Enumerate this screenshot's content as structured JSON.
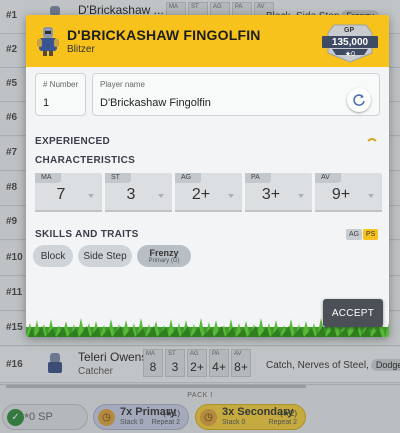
{
  "roster": {
    "rows": [
      {
        "num": "#1",
        "name": "D'Brickashaw ...",
        "skills": "Block, Side Step",
        "badge": "Frenzy"
      },
      {
        "num": "#2",
        "name": "",
        "skills": "",
        "badge": ""
      },
      {
        "num": "#5",
        "name": "",
        "skills": "",
        "badge": ""
      },
      {
        "num": "#6",
        "name": "",
        "skills": "",
        "badge": ""
      },
      {
        "num": "#7",
        "name": "",
        "skills": "",
        "badge": ""
      },
      {
        "num": "#8",
        "name": "",
        "skills": "",
        "badge": ""
      },
      {
        "num": "#9",
        "name": "",
        "skills": "",
        "badge": ""
      },
      {
        "num": "#10",
        "name": "",
        "skills": "",
        "badge": ""
      },
      {
        "num": "#11",
        "name": "",
        "skills": "",
        "badge": ""
      },
      {
        "num": "#15",
        "name": "",
        "skills": "",
        "badge": ""
      },
      {
        "num": "#16",
        "name": "Teleri Owens",
        "position": "Catcher",
        "skills": "Catch, Nerves of Steel,",
        "badge": "Dodge",
        "stats": [
          {
            "label": "MA",
            "value": "8"
          },
          {
            "label": "ST",
            "value": "3"
          },
          {
            "label": "AG",
            "value": "2+"
          },
          {
            "label": "PA",
            "value": "4+"
          },
          {
            "label": "AV",
            "value": "8+"
          }
        ]
      }
    ],
    "first_row_stat_labels": [
      "MA",
      "ST",
      "AG",
      "PA",
      "AV"
    ]
  },
  "pack": {
    "label": "PACK I",
    "items": [
      {
        "title": "0 SP",
        "star": "★"
      },
      {
        "title": "7x Primary",
        "star": "(★1)",
        "stack": "Stack 0",
        "repeat": "Repeat 2"
      },
      {
        "title": "3x Secondary",
        "star": "(★2)",
        "stack": "Stack 0",
        "repeat": "Repeat 2"
      }
    ]
  },
  "modal": {
    "player_name": "D'BRICKASHAW FINGOLFIN",
    "position": "Blitzer",
    "gp": {
      "caption": "GP",
      "value": "135,000",
      "sub": "★0"
    },
    "number": {
      "label": "# Number",
      "value": "1"
    },
    "name_field": {
      "label": "Player name",
      "value": "D'Brickashaw Fingolfin"
    },
    "experienced_label": "EXPERIENCED",
    "characteristics_label": "CHARACTERISTICS",
    "characteristics": [
      {
        "label": "MA",
        "value": "7"
      },
      {
        "label": "ST",
        "value": "3"
      },
      {
        "label": "AG",
        "value": "2+"
      },
      {
        "label": "PA",
        "value": "3+"
      },
      {
        "label": "AV",
        "value": "9+"
      }
    ],
    "skills_label": "SKILLS AND TRAITS",
    "tags": [
      "AG",
      "PS"
    ],
    "skills": [
      {
        "name": "Block"
      },
      {
        "name": "Side Step"
      },
      {
        "name": "Frenzy",
        "sub": "Primary (G)"
      }
    ],
    "accept_label": "ACCEPT"
  },
  "colors": {
    "header": "#f6c21b",
    "accept": "#4a5056",
    "grass": "#3f9a2a"
  }
}
